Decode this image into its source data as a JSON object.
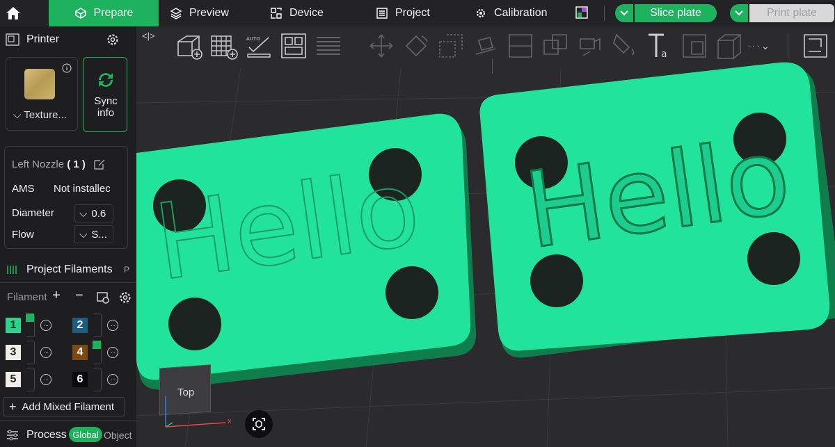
{
  "topbar": {
    "tabs": [
      {
        "label": "Prepare",
        "icon": "cube-icon",
        "active": true
      },
      {
        "label": "Preview",
        "icon": "layers-icon"
      },
      {
        "label": "Device",
        "icon": "device-icon"
      },
      {
        "label": "Project",
        "icon": "list-icon"
      },
      {
        "label": "Calibration",
        "icon": "gear-icon"
      }
    ],
    "slice_label": "Slice plate",
    "print_label": "Print plate"
  },
  "sidebar": {
    "printer_title": "Printer",
    "plate_label": "Texture...",
    "sync_label": "Sync\ninfo",
    "nozzle_label": "Left Nozzle",
    "nozzle_count": "( 1 )",
    "ams_label": "AMS",
    "ams_value": "Not installec",
    "diameter_label": "Diameter",
    "diameter_value": "0.6",
    "flow_label": "Flow",
    "flow_value": "S...",
    "project_filaments_title": "Project Filaments",
    "project_filaments_trailing": "P",
    "filament_label": "Filament",
    "filaments": [
      {
        "number": "1",
        "color": "#2ed28a",
        "text_color": "#0e3b26"
      },
      {
        "number": "2",
        "color": "#1d5e80",
        "text_color": "#ffffff"
      },
      {
        "number": "3",
        "color": "#f0eee8",
        "text_color": "#222222"
      },
      {
        "number": "4",
        "color": "#7a4a12",
        "text_color": "#ffffff"
      },
      {
        "number": "5",
        "color": "#f0eee8",
        "text_color": "#222222"
      },
      {
        "number": "6",
        "color": "#0a0a0a",
        "text_color": "#ffffff"
      }
    ],
    "add_mixed_label": "Add Mixed Filament",
    "process_title": "Process",
    "process_global": "Global",
    "process_object": "Object"
  },
  "viewport": {
    "cube_label": "Top",
    "axis_x": "x",
    "model_text": "Hello",
    "accent_color": "#1fe09a"
  },
  "colors": {
    "brand_green": "#1fb25e",
    "background": "#2b2b2e",
    "sidebar": "#1e1e21"
  }
}
